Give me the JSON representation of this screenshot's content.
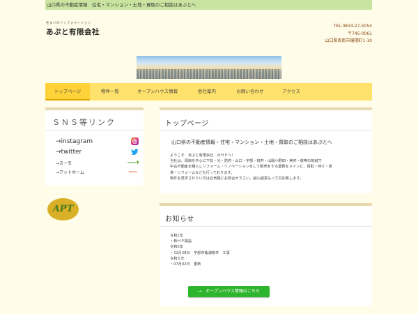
{
  "topbar": {
    "text": "山口県の不動産情報　住宅・マンション・土地・買取のご相談はあぷとへ"
  },
  "logo": {
    "tagline": "住まいのインフォメーション",
    "name": "あぷと有限会社"
  },
  "contact": {
    "tel": "TEL.0834-27-5054",
    "postal": "〒745-0061",
    "address": "山口県周南市鐘楼町1-10"
  },
  "nav": {
    "items": [
      {
        "label": "トップページ",
        "active": true
      },
      {
        "label": "物件一覧"
      },
      {
        "label": "オープンハウス情報"
      },
      {
        "label": "会社案内"
      },
      {
        "label": "お問い合わせ"
      },
      {
        "label": "アクセス"
      }
    ]
  },
  "sns": {
    "title": "ＳＮＳ等リンク",
    "items": [
      {
        "label": "→instagram",
        "icon": "instagram-icon",
        "icon_text": "",
        "color": "#c13584"
      },
      {
        "label": "→twitter",
        "icon": "twitter-icon",
        "icon_text": "",
        "color": "#1da1f2"
      },
      {
        "label": "→スーモ",
        "icon": "suumo-icon",
        "icon_text": "SUUMO",
        "color": "#59a92d"
      },
      {
        "label": "→アットホーム",
        "icon": "athome-icon",
        "icon_text": "athome",
        "color": "#e8541f"
      }
    ]
  },
  "apt_logo": {
    "text": "APT"
  },
  "top": {
    "title": "トップページ",
    "lead": "山口県の不動産情報・住宅・マンション・土地・買取のご相談はあぷとへ",
    "lines": [
      "ようこそ　あぷと有限会社　のＨＰへ！",
      "当社は、周南を中心に下松・光・防府・山口・宇部・柳井・山陽小野田・美祢・萩等の地域で",
      "中古不動産を購入しリフォーム・リノベーションをして販売をする業務をメインに、買取・仲介・賃",
      "貸・リフォームなども行っております。",
      "物件を見学されたい方はお気軽にお問合せ下さい。誠心誠意もって対応致します。"
    ]
  },
  "news": {
    "title": "お知らせ",
    "lines": [
      "令和1年",
      "・新ＨＰ開設",
      "令和5年",
      "・12月28日　宇部市亀浦物件　工事",
      "令和６年",
      "・07月02日　更新"
    ],
    "cta": "→　オープンハウス情報はこちら"
  }
}
